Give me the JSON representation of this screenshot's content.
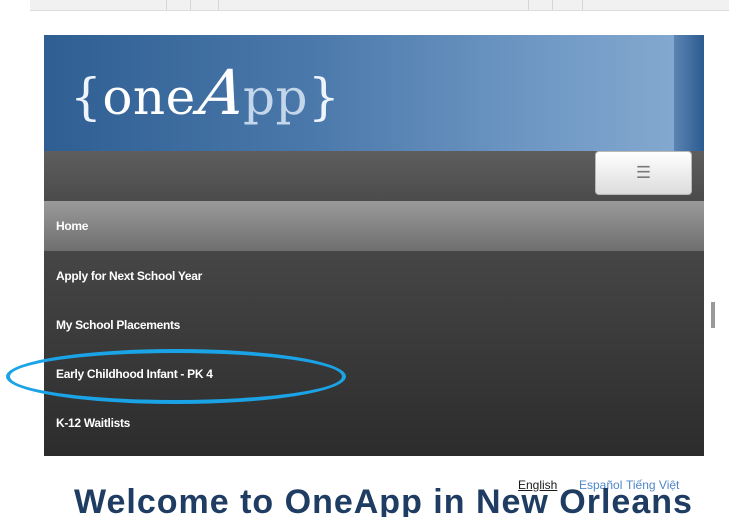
{
  "logo": {
    "brace_open": "{",
    "one": "one",
    "a": "A",
    "pp": "pp",
    "brace_close": "}"
  },
  "menu_toggle": {
    "icon": "hamburger-icon",
    "glyph": "☰"
  },
  "menu": {
    "items": [
      {
        "label": "Home",
        "active": true
      },
      {
        "label": "Apply for Next School Year"
      },
      {
        "label": "My School Placements"
      },
      {
        "label": "Early Childhood Infant - PK 4"
      },
      {
        "label": "K-12 Waitlists"
      }
    ]
  },
  "languages": {
    "english": "English",
    "espanol": "Español",
    "vietnamese": "Tiếng Việt"
  },
  "welcome": "Welcome to OneApp in New Orleans",
  "colors": {
    "header_blue": "#2f5e93",
    "menu_dark": "#2c2c2c",
    "highlight": "#1aa3e6",
    "link": "#4d86c8"
  }
}
